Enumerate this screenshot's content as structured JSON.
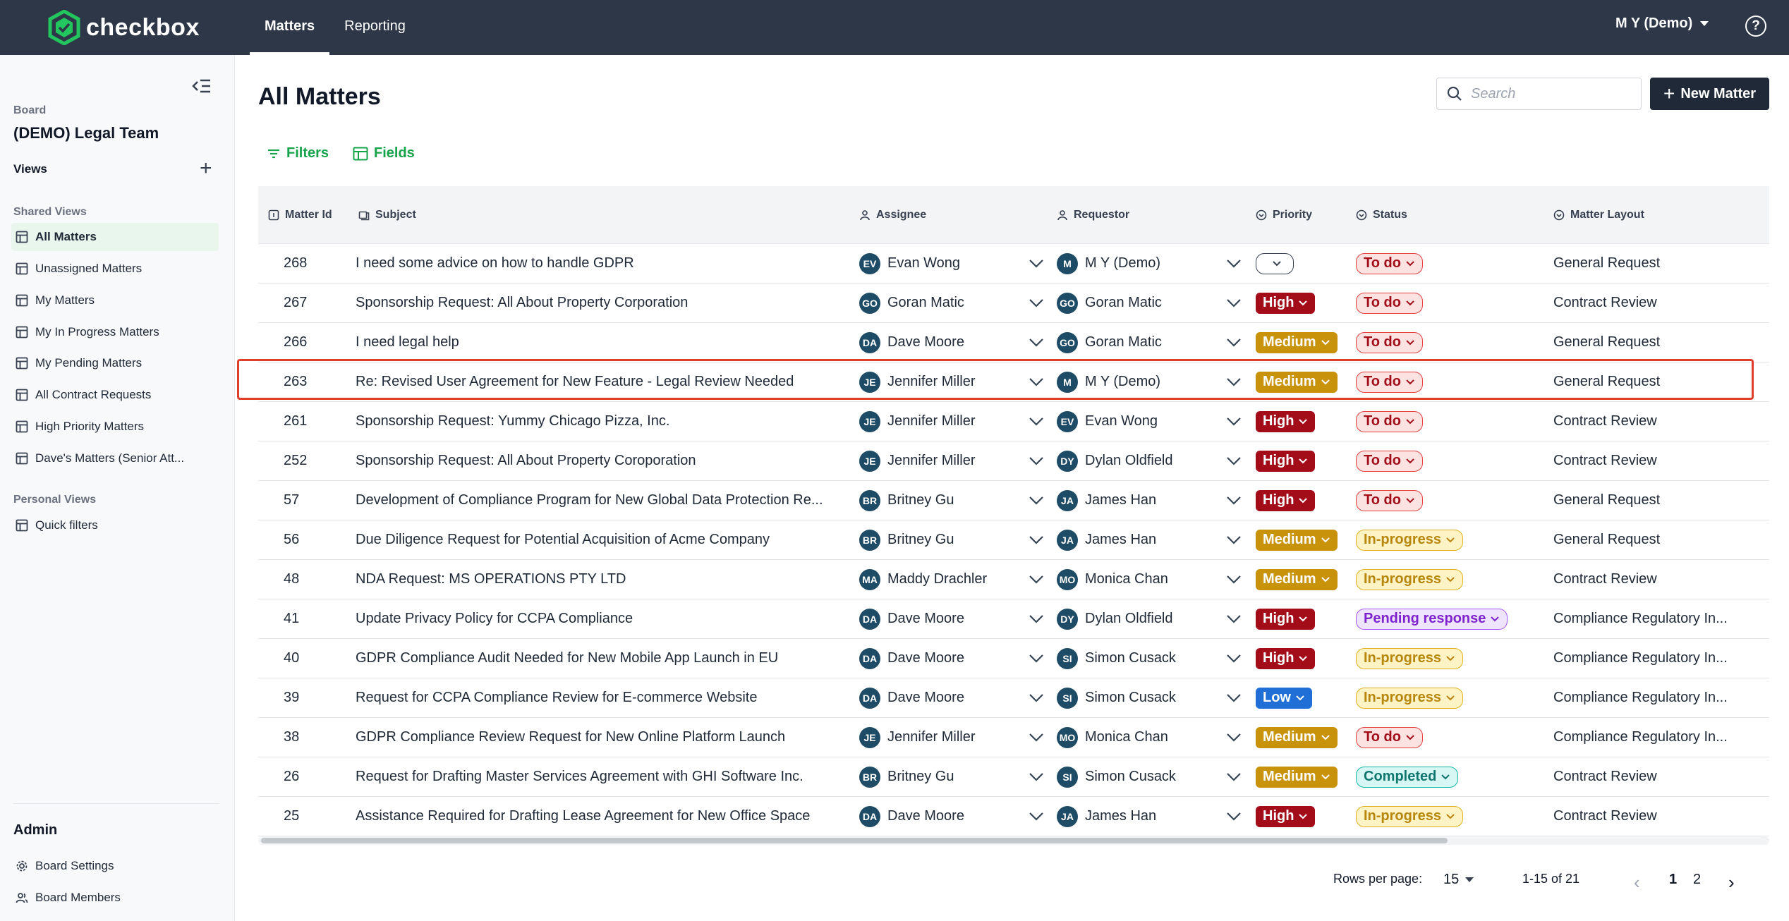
{
  "app": {
    "brand": "checkbox",
    "nav_tabs": [
      {
        "label": "Matters",
        "active": true
      },
      {
        "label": "Reporting",
        "active": false
      }
    ],
    "user_menu": "M Y (Demo)",
    "accent_color": "#16a34a",
    "header_bg": "#2d3748"
  },
  "sidebar": {
    "board_label": "Board",
    "board_name": "(DEMO) Legal Team",
    "views_label": "Views",
    "shared_views_label": "Shared Views",
    "shared_views": [
      {
        "label": "All Matters",
        "active": true
      },
      {
        "label": "Unassigned Matters"
      },
      {
        "label": "My Matters"
      },
      {
        "label": "My In Progress Matters"
      },
      {
        "label": "My Pending Matters"
      },
      {
        "label": "All Contract Requests"
      },
      {
        "label": "High Priority Matters"
      },
      {
        "label": "Dave's Matters (Senior Att..."
      }
    ],
    "personal_views_label": "Personal Views",
    "personal_views": [
      {
        "label": "Quick filters"
      }
    ],
    "admin_label": "Admin",
    "admin_items": [
      {
        "label": "Board Settings",
        "icon": "gear-icon"
      },
      {
        "label": "Board Members",
        "icon": "users-icon"
      }
    ]
  },
  "main": {
    "title": "All Matters",
    "search_placeholder": "Search",
    "new_matter_label": "New Matter",
    "filters_label": "Filters",
    "fields_label": "Fields"
  },
  "table": {
    "columns": [
      "Matter Id",
      "Subject",
      "Assignee",
      "Requestor",
      "Priority",
      "Status",
      "Matter Layout"
    ],
    "rows": [
      {
        "id": "268",
        "subject": "I need some advice on how to handle GDPR",
        "assignee": {
          "initials": "EV",
          "name": "Evan Wong"
        },
        "requestor": {
          "initials": "M",
          "name": "M Y (Demo)"
        },
        "priority": "",
        "status": "To do",
        "layout": "General Request"
      },
      {
        "id": "267",
        "subject": "Sponsorship Request: All About Property Corporation",
        "assignee": {
          "initials": "GO",
          "name": "Goran Matic"
        },
        "requestor": {
          "initials": "GO",
          "name": "Goran Matic"
        },
        "priority": "High",
        "status": "To do",
        "layout": "Contract Review"
      },
      {
        "id": "266",
        "subject": "I need legal help",
        "assignee": {
          "initials": "DA",
          "name": "Dave Moore"
        },
        "requestor": {
          "initials": "GO",
          "name": "Goran Matic"
        },
        "priority": "Medium",
        "status": "To do",
        "layout": "General Request"
      },
      {
        "id": "263",
        "subject": "Re: Revised User Agreement for New Feature - Legal Review Needed",
        "assignee": {
          "initials": "JE",
          "name": "Jennifer Miller"
        },
        "requestor": {
          "initials": "M",
          "name": "M Y (Demo)"
        },
        "priority": "Medium",
        "status": "To do",
        "layout": "General Request"
      },
      {
        "id": "261",
        "subject": "Sponsorship Request: Yummy Chicago Pizza, Inc.",
        "assignee": {
          "initials": "JE",
          "name": "Jennifer Miller"
        },
        "requestor": {
          "initials": "EV",
          "name": "Evan Wong"
        },
        "priority": "High",
        "status": "To do",
        "layout": "Contract Review"
      },
      {
        "id": "252",
        "subject": "Sponsorship Request: All About Property Coroporation",
        "assignee": {
          "initials": "JE",
          "name": "Jennifer Miller"
        },
        "requestor": {
          "initials": "DY",
          "name": "Dylan Oldfield"
        },
        "priority": "High",
        "status": "To do",
        "layout": "Contract Review"
      },
      {
        "id": "57",
        "subject": "Development of Compliance Program for New Global Data Protection Re...",
        "assignee": {
          "initials": "BR",
          "name": "Britney Gu"
        },
        "requestor": {
          "initials": "JA",
          "name": "James Han"
        },
        "priority": "High",
        "status": "To do",
        "layout": "General Request"
      },
      {
        "id": "56",
        "subject": "Due Diligence Request for Potential Acquisition of Acme Company",
        "assignee": {
          "initials": "BR",
          "name": "Britney Gu"
        },
        "requestor": {
          "initials": "JA",
          "name": "James Han"
        },
        "priority": "Medium",
        "status": "In-progress",
        "layout": "General Request"
      },
      {
        "id": "48",
        "subject": "NDA Request: MS OPERATIONS PTY LTD",
        "assignee": {
          "initials": "MA",
          "name": "Maddy Drachler"
        },
        "requestor": {
          "initials": "MO",
          "name": "Monica Chan"
        },
        "priority": "Medium",
        "status": "In-progress",
        "layout": "Contract Review"
      },
      {
        "id": "41",
        "subject": "Update Privacy Policy for CCPA Compliance",
        "assignee": {
          "initials": "DA",
          "name": "Dave Moore"
        },
        "requestor": {
          "initials": "DY",
          "name": "Dylan Oldfield"
        },
        "priority": "High",
        "status": "Pending response",
        "layout": "Compliance Regulatory In..."
      },
      {
        "id": "40",
        "subject": "GDPR Compliance Audit Needed for New Mobile App Launch in EU",
        "assignee": {
          "initials": "DA",
          "name": "Dave Moore"
        },
        "requestor": {
          "initials": "SI",
          "name": "Simon Cusack"
        },
        "priority": "High",
        "status": "In-progress",
        "layout": "Compliance Regulatory In..."
      },
      {
        "id": "39",
        "subject": "Request for CCPA Compliance Review for E-commerce Website",
        "assignee": {
          "initials": "DA",
          "name": "Dave Moore"
        },
        "requestor": {
          "initials": "SI",
          "name": "Simon Cusack"
        },
        "priority": "Low",
        "status": "In-progress",
        "layout": "Compliance Regulatory In..."
      },
      {
        "id": "38",
        "subject": "GDPR Compliance Review Request for New Online Platform Launch",
        "assignee": {
          "initials": "JE",
          "name": "Jennifer Miller"
        },
        "requestor": {
          "initials": "MO",
          "name": "Monica Chan"
        },
        "priority": "Medium",
        "status": "To do",
        "layout": "Compliance Regulatory In..."
      },
      {
        "id": "26",
        "subject": "Request for Drafting Master Services Agreement with GHI Software Inc.",
        "assignee": {
          "initials": "BR",
          "name": "Britney Gu"
        },
        "requestor": {
          "initials": "SI",
          "name": "Simon Cusack"
        },
        "priority": "Medium",
        "status": "Completed",
        "layout": "Contract Review"
      },
      {
        "id": "25",
        "subject": "Assistance Required for Drafting Lease Agreement for New Office Space",
        "assignee": {
          "initials": "DA",
          "name": "Dave Moore"
        },
        "requestor": {
          "initials": "JA",
          "name": "James Han"
        },
        "priority": "High",
        "status": "In-progress",
        "layout": "Contract Review"
      }
    ]
  },
  "pagination": {
    "rows_per_page_label": "Rows per page:",
    "rows_per_page": "15",
    "range": "1-15 of 21",
    "pages": [
      "1",
      "2"
    ],
    "current_page": "1"
  }
}
